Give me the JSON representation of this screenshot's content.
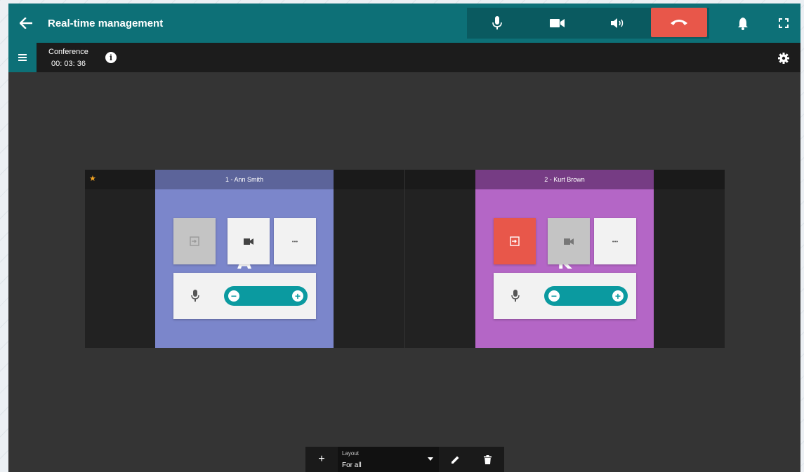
{
  "header": {
    "title": "Real-time management",
    "icons": {
      "back": "arrow-left-icon",
      "mic": "microphone-icon",
      "camera": "video-camera-icon",
      "speaker": "speaker-volume-icon",
      "hangup": "phone-hangup-icon",
      "notifications": "bell-icon",
      "fullscreen": "fullscreen-icon"
    }
  },
  "subbar": {
    "conference_label": "Conference",
    "timer": "00: 03: 36",
    "info_glyph": "i",
    "icons": {
      "list": "list-icon",
      "info": "info-icon",
      "settings": "gear-icon"
    }
  },
  "tiles": [
    {
      "name": "1 - Ann Smith",
      "letter": "A",
      "starred": true,
      "star_glyph": "★",
      "color": "#7b86cb",
      "header_color": "#5c649a",
      "entry_button_color": "#c4c4c4"
    },
    {
      "name": "2 - Kurt Brown",
      "letter": "K",
      "starred": false,
      "color": "#b466c6",
      "header_color": "#763c84",
      "entry_button_color": "#e8574a"
    }
  ],
  "tile_controls": {
    "more_glyph": "•••",
    "vol_minus": "−",
    "vol_plus": "+"
  },
  "layout_bar": {
    "add_glyph": "+",
    "label": "Layout",
    "value": "For all"
  },
  "colors": {
    "primary": "#0d7077",
    "hangup": "#e8574a",
    "accent": "#0b9aa0"
  }
}
